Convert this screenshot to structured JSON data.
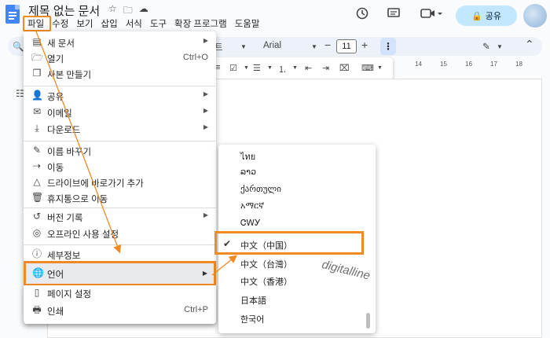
{
  "header": {
    "title": "제목 없는 문서",
    "title_icons": [
      "star-icon",
      "folder-move-icon",
      "cloud-status-icon"
    ],
    "menus": [
      "파일",
      "수정",
      "보기",
      "삽입",
      "서식",
      "도구",
      "확장 프로그램",
      "도움말"
    ],
    "share_label": "공유"
  },
  "toolbar": {
    "style_suffix": "트",
    "font": "Arial",
    "font_size": "11",
    "more": "⋮"
  },
  "ruler": [
    "14",
    "15",
    "16",
    "17",
    "18"
  ],
  "file_menu": {
    "items": [
      {
        "label": "새 문서",
        "shortcut": "",
        "submenu": true,
        "icon": "new-doc-icon"
      },
      {
        "label": "열기",
        "shortcut": "Ctrl+O",
        "submenu": false,
        "icon": "open-folder-icon"
      },
      {
        "label": "사본 만들기",
        "shortcut": "",
        "submenu": false,
        "icon": "copy-icon"
      },
      {
        "label": "공유",
        "shortcut": "",
        "submenu": true,
        "icon": "person-add-icon"
      },
      {
        "label": "이메일",
        "shortcut": "",
        "submenu": true,
        "icon": "email-icon"
      },
      {
        "label": "다운로드",
        "shortcut": "",
        "submenu": true,
        "icon": "download-icon"
      },
      {
        "label": "이름 바꾸기",
        "shortcut": "",
        "submenu": false,
        "icon": "rename-icon"
      },
      {
        "label": "이동",
        "shortcut": "",
        "submenu": false,
        "icon": "move-icon"
      },
      {
        "label": "드라이브에 바로가기 추가",
        "shortcut": "",
        "submenu": false,
        "icon": "drive-shortcut-icon"
      },
      {
        "label": "휴지통으로 이동",
        "shortcut": "",
        "submenu": false,
        "icon": "trash-icon"
      },
      {
        "label": "버전 기록",
        "shortcut": "",
        "submenu": true,
        "icon": "history-icon"
      },
      {
        "label": "오프라인 사용 설정",
        "shortcut": "",
        "submenu": false,
        "icon": "offline-icon"
      },
      {
        "label": "세부정보",
        "shortcut": "",
        "submenu": false,
        "icon": "info-icon"
      },
      {
        "label": "언어",
        "shortcut": "",
        "submenu": true,
        "icon": "globe-icon"
      },
      {
        "label": "페이지 설정",
        "shortcut": "",
        "submenu": false,
        "icon": "page-setup-icon"
      },
      {
        "label": "인쇄",
        "shortcut": "Ctrl+P",
        "submenu": false,
        "icon": "print-icon"
      }
    ]
  },
  "language_menu": {
    "items": [
      {
        "label": "ไทย",
        "checked": false
      },
      {
        "label": "ລາວ",
        "checked": false
      },
      {
        "label": "ქართული",
        "checked": false
      },
      {
        "label": "አማርኛ",
        "checked": false
      },
      {
        "label": "ᏣᎳᎩ",
        "checked": false
      },
      {
        "label": "中文（中国）",
        "checked": true
      },
      {
        "label": "中文（台灣）",
        "checked": false
      },
      {
        "label": "中文（香港）",
        "checked": false
      },
      {
        "label": "日本語",
        "checked": false
      },
      {
        "label": "한국어",
        "checked": false
      }
    ]
  },
  "watermark": "digitalline",
  "colors": {
    "highlight": "#f08a24",
    "share_bg": "#c2e7ff",
    "toolbar_bg": "#edf2fa",
    "docs_blue": "#4285f4"
  }
}
